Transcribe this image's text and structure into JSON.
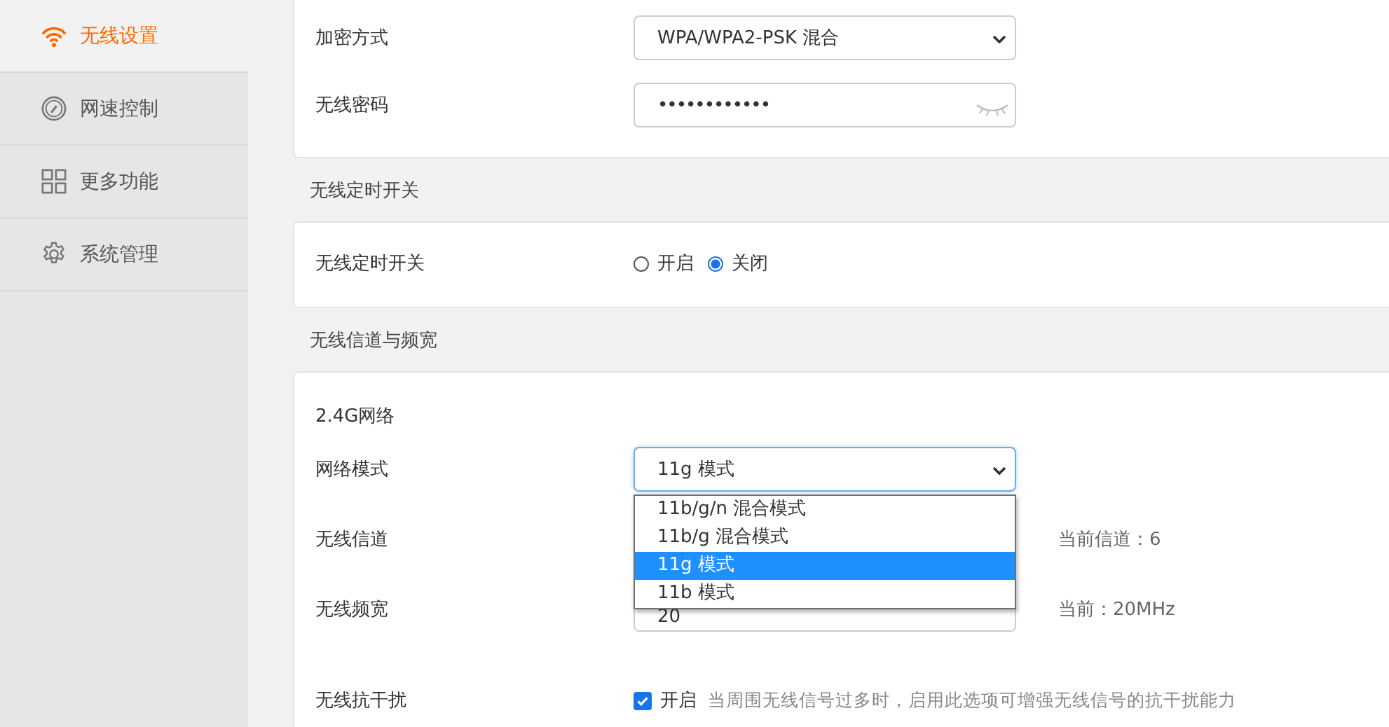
{
  "sidebar": {
    "items": [
      {
        "label": "无线设置",
        "selected": true
      },
      {
        "label": "网速控制",
        "selected": false
      },
      {
        "label": "更多功能",
        "selected": false
      },
      {
        "label": "系统管理",
        "selected": false
      }
    ]
  },
  "security": {
    "rows": [
      {
        "kind": "select",
        "label": "加密方式",
        "value": "WPA/WPA2-PSK 混合"
      },
      {
        "kind": "password",
        "label": "无线密码",
        "value": "••••••••••••"
      }
    ]
  },
  "schedule": {
    "title": "无线定时开关",
    "label": "无线定时开关",
    "options": [
      {
        "label": "开启",
        "selected": false
      },
      {
        "label": "关闭",
        "selected": true
      }
    ]
  },
  "channel": {
    "title": "无线信道与频宽",
    "subtitle": "2.4G网络",
    "mode": {
      "label": "网络模式",
      "value": "11g 模式",
      "expanded": true,
      "options": [
        {
          "label": "11b/g/n 混合模式",
          "selected": false
        },
        {
          "label": "11b/g 混合模式",
          "selected": false
        },
        {
          "label": "11g 模式",
          "selected": true
        },
        {
          "label": "11b 模式",
          "selected": false
        }
      ]
    },
    "channel_row": {
      "label": "无线信道",
      "note": "当前信道：6"
    },
    "bandwidth": {
      "label": "无线频宽",
      "value": "20",
      "note": "当前：20MHz"
    },
    "anti": {
      "label": "无线抗干扰",
      "checked": true,
      "option": "开启",
      "hint": "当周围无线信号过多时，启用此选项可增强无线信号的抗干扰能力"
    }
  }
}
